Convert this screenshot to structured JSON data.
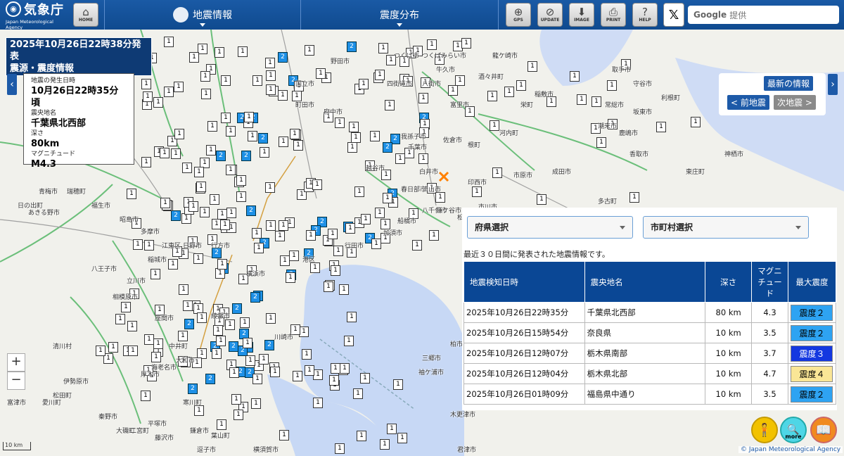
{
  "header": {
    "logo_text": "気象庁",
    "logo_sub": "Japan Meteorological Agency",
    "home_label": "HOME",
    "menu1": "地震情報",
    "menu2": "震度分布",
    "tools": [
      {
        "name": "gps-button",
        "icon": "gps-icon",
        "label": "GPS"
      },
      {
        "name": "update-button",
        "icon": "update-icon",
        "label": "UPDATE"
      },
      {
        "name": "image-button",
        "icon": "download-icon",
        "label": "IMAGE"
      },
      {
        "name": "print-button",
        "icon": "printer-icon",
        "label": "PRINT"
      },
      {
        "name": "help-button",
        "icon": "help-icon",
        "label": "HELP"
      }
    ],
    "x_label": "𝕏",
    "google_label": "Google",
    "google_placeholder": "提供"
  },
  "issue": {
    "line1": "2025年10月26日22時38分発表",
    "line2": "震源・震度情報"
  },
  "quake": {
    "time_label": "地震の発生日時",
    "time": "10月26日22時35分頃",
    "place_label": "震央地名",
    "place": "千葉県北西部",
    "depth_label": "深さ",
    "depth": "80km",
    "mag_label": "マグニチュード",
    "mag": "M4.3"
  },
  "nav": {
    "latest": "最新の情報",
    "prev": "< 前地震",
    "next": "次地震 >"
  },
  "panel": {
    "pref_select": "府県選択",
    "city_select": "市町村選択",
    "note": "最近３０日間に発表された地震情報です。",
    "headers": [
      "地震検知日時",
      "震央地名",
      "深さ",
      "マグニチュード",
      "最大震度"
    ],
    "rows": [
      {
        "time": "2025年10月26日22時35分",
        "place": "千葉県北西部",
        "depth": "80 km",
        "mag": "4.3",
        "intensity": "震度２",
        "color": "#2ea3f2",
        "text": "#000"
      },
      {
        "time": "2025年10月26日15時54分",
        "place": "奈良県",
        "depth": "10 km",
        "mag": "3.5",
        "intensity": "震度２",
        "color": "#2ea3f2",
        "text": "#000"
      },
      {
        "time": "2025年10月26日12時07分",
        "place": "栃木県南部",
        "depth": "10 km",
        "mag": "3.7",
        "intensity": "震度３",
        "color": "#1438e0",
        "text": "#fff"
      },
      {
        "time": "2025年10月26日12時04分",
        "place": "栃木県北部",
        "depth": "10 km",
        "mag": "4.7",
        "intensity": "震度４",
        "color": "#fae696",
        "text": "#000"
      },
      {
        "time": "2025年10月26日01時09分",
        "place": "福島県中通り",
        "depth": "10 km",
        "mag": "3.5",
        "intensity": "震度２",
        "color": "#2ea3f2",
        "text": "#000"
      }
    ]
  },
  "map": {
    "scale": "10 km",
    "copyright": "© Japan Meteorological Agency",
    "more_label": "more",
    "epicenter_color": "#ff8000",
    "place_labels": [
      "野田市",
      "我孫子市",
      "白井市",
      "印西市",
      "成田市",
      "香取市",
      "神栖市",
      "東庄町",
      "多古町",
      "八千代市",
      "船橋市",
      "根町",
      "河内町",
      "稲敷市",
      "日の出町",
      "あきる野市",
      "青梅市",
      "瑞穂町",
      "福生市",
      "昭島市",
      "八王子市",
      "相模原市",
      "座間市",
      "厚木市",
      "伊勢原市",
      "清川村",
      "愛川町",
      "秦野市",
      "大磯町",
      "二宮町",
      "平塚市",
      "寒川町",
      "藤沢市",
      "鎌倉市",
      "逗子市",
      "横須賀市",
      "葉山町",
      "木更津市",
      "君津市",
      "袖ケ浦市",
      "富津市",
      "松田町",
      "中井町",
      "大和市",
      "海老名市",
      "綾瀬市",
      "川崎市",
      "横浜市",
      "港区",
      "江東区",
      "稲城市",
      "多摩市",
      "日野市",
      "立川市",
      "国立市",
      "府中市",
      "町田市",
      "越谷市",
      "春日部市",
      "加須市",
      "行田市",
      "松伏町",
      "三郷市",
      "柏市",
      "流山市",
      "鎌ケ谷市",
      "市川市",
      "浦安市",
      "市原市",
      "千葉市",
      "佐倉市",
      "四街道市",
      "八街市",
      "富里市",
      "酒々井町",
      "栄町",
      "取手市",
      "守谷市",
      "常総市",
      "坂東市",
      "つくばみらい市",
      "つくば市",
      "牛久市",
      "龍ケ崎市",
      "利根町",
      "鹿嶋市",
      "潮来市",
      "行方市",
      "鉾田市",
      "土浦市",
      "阿見町",
      "美浦村",
      "稲城市"
    ],
    "markers": [
      1,
      2
    ]
  }
}
